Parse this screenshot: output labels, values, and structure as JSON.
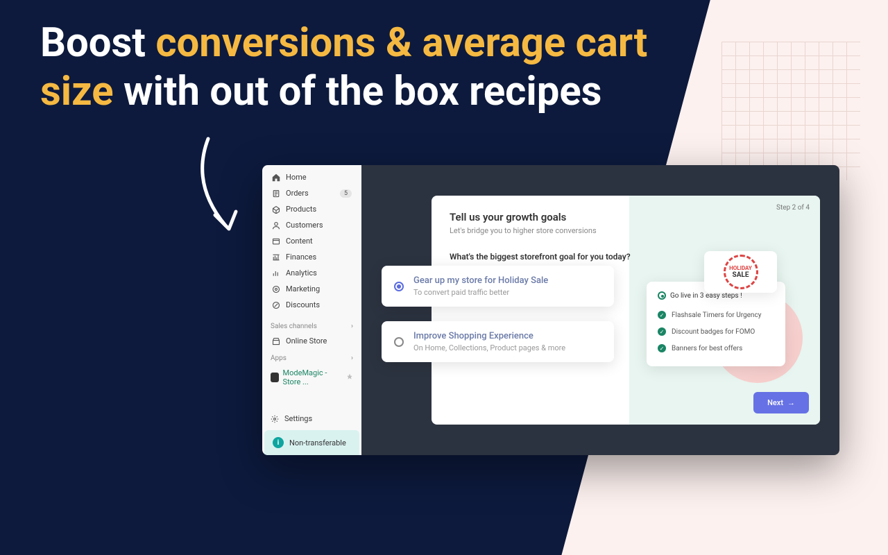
{
  "headline": {
    "part1": "Boost ",
    "highlight": "conversions & average cart size",
    "part2": " with out of the box recipes"
  },
  "sidebar": {
    "nav": [
      {
        "icon": "home",
        "label": "Home"
      },
      {
        "icon": "orders",
        "label": "Orders",
        "badge": "5"
      },
      {
        "icon": "products",
        "label": "Products"
      },
      {
        "icon": "customers",
        "label": "Customers"
      },
      {
        "icon": "content",
        "label": "Content"
      },
      {
        "icon": "finances",
        "label": "Finances"
      },
      {
        "icon": "analytics",
        "label": "Analytics"
      },
      {
        "icon": "marketing",
        "label": "Marketing"
      },
      {
        "icon": "discounts",
        "label": "Discounts"
      }
    ],
    "sections": {
      "channels": "Sales channels",
      "apps": "Apps"
    },
    "online_store": "Online Store",
    "app_name": "ModeMagic - Store ...",
    "settings": "Settings",
    "non_transferable": "Non-transferable"
  },
  "panel": {
    "title": "Tell us your growth goals",
    "subtitle": "Let's bridge you to higher store conversions",
    "question": "What's the biggest storefront goal for you today?",
    "step": "Step 2 of 4",
    "options": [
      {
        "title": "Gear up my store for Holiday Sale",
        "sub": "To convert paid traffic better"
      },
      {
        "title": "Improve Shopping Experience",
        "sub": "On Home, Collections, Product pages & more"
      }
    ],
    "promo": {
      "title": "Go live in 3 easy steps !",
      "items": [
        "Flashsale Timers  for Urgency",
        "Discount badges for FOMO",
        "Banners for best offers"
      ]
    },
    "badge": {
      "line1": "HOLIDAY",
      "line2": "SALE"
    },
    "next": "Next"
  }
}
